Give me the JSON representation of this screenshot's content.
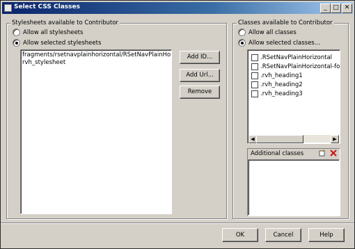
{
  "window": {
    "title": "Select CSS Classes"
  },
  "titlebar_buttons": {
    "minimize": "_",
    "maximize": "□",
    "close": "✕"
  },
  "left": {
    "group_label": "Stylesheets available to Contributor",
    "radio_all": "Allow all stylesheets",
    "radio_selected": "Allow selected stylesheets",
    "selected_option": "selected",
    "items": [
      "fragments/rsetnavplainhorizontal/RSetNavPlainHorizontal.css",
      "rvh_stylesheet"
    ],
    "buttons": {
      "add_id": "Add ID...",
      "add_url": "Add Url...",
      "remove": "Remove"
    }
  },
  "right": {
    "group_label": "Classes available to Contributor",
    "radio_all": "Allow all classes",
    "radio_selected": "Allow selected classes...",
    "selected_option": "selected",
    "classes": [
      {
        "name": ".RSetNavPlainHorizontal",
        "checked": false
      },
      {
        "name": ".RSetNavPlainHorizontal-focus",
        "checked": false
      },
      {
        "name": ".rvh_heading1",
        "checked": false
      },
      {
        "name": ".rvh_heading2",
        "checked": false
      },
      {
        "name": ".rvh_heading3",
        "checked": false
      }
    ],
    "additional_label": "Additional classes",
    "icons": {
      "add": "add-class-icon",
      "delete": "delete-class-icon"
    }
  },
  "footer": {
    "ok": "OK",
    "cancel": "Cancel",
    "help": "Help"
  }
}
